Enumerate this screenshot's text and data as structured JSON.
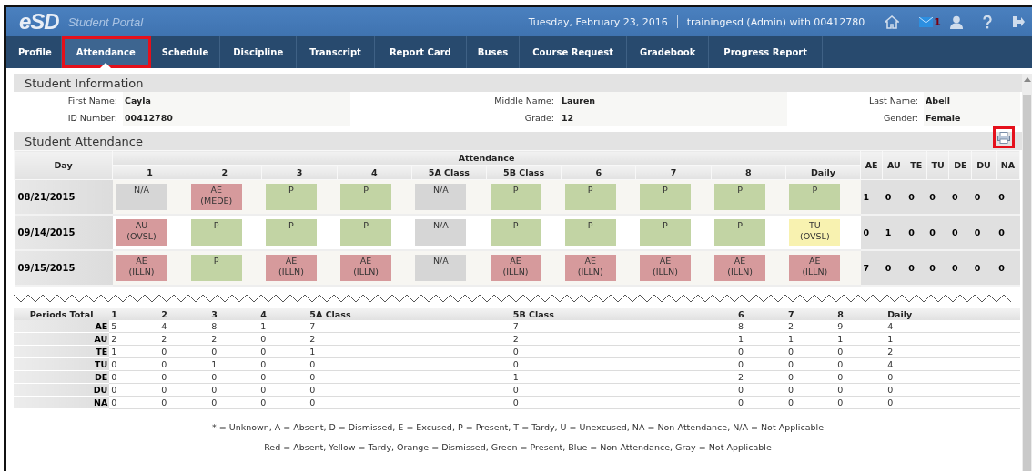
{
  "header": {
    "logo": "eSD",
    "portal_name": "Student Portal",
    "date": "Tuesday, February 23, 2016",
    "user": "trainingesd (Admin) with 00412780",
    "mail_count": "1"
  },
  "tabs": [
    {
      "label": "Profile",
      "selected": false,
      "highlighted": false
    },
    {
      "label": "Attendance",
      "selected": true,
      "highlighted": true
    },
    {
      "label": "Schedule",
      "selected": false,
      "highlighted": false
    },
    {
      "label": "Discipline",
      "selected": false,
      "highlighted": false
    },
    {
      "label": "Transcript",
      "selected": false,
      "highlighted": false
    },
    {
      "label": "Report Card",
      "selected": false,
      "highlighted": false
    },
    {
      "label": "Buses",
      "selected": false,
      "highlighted": false
    },
    {
      "label": "Course Request",
      "selected": false,
      "highlighted": false
    },
    {
      "label": "Gradebook",
      "selected": false,
      "highlighted": false
    },
    {
      "label": "Progress Report",
      "selected": false,
      "highlighted": false
    }
  ],
  "student_information": {
    "title": "Student Information",
    "fields": [
      {
        "label": "First Name:",
        "value": "Cayla"
      },
      {
        "label": "Middle Name:",
        "value": "Lauren"
      },
      {
        "label": "Last Name:",
        "value": "Abell"
      },
      {
        "label": "ID Number:",
        "value": "00412780"
      },
      {
        "label": "Grade:",
        "value": "12"
      },
      {
        "label": "Gender:",
        "value": "Female"
      }
    ]
  },
  "student_attendance": {
    "title": "Student Attendance",
    "print_highlighted": true,
    "day_header": "Day",
    "group_header": "Attendance",
    "periods": [
      "1",
      "2",
      "3",
      "4",
      "5A Class",
      "5B Class",
      "6",
      "7",
      "8",
      "Daily"
    ],
    "totals_columns": [
      "AE",
      "AU",
      "TE",
      "TU",
      "DE",
      "DU",
      "NA"
    ],
    "rows": [
      {
        "day": "08/21/2015",
        "cells": [
          {
            "code": "N/A",
            "color": "#d6d6d6"
          },
          {
            "code": "AE",
            "reason": "(MEDE)",
            "color": "#d69a9c"
          },
          {
            "code": "P",
            "color": "#c2d4a4"
          },
          {
            "code": "P",
            "color": "#c2d4a4"
          },
          {
            "code": "N/A",
            "color": "#d6d6d6"
          },
          {
            "code": "P",
            "color": "#c2d4a4"
          },
          {
            "code": "P",
            "color": "#c2d4a4"
          },
          {
            "code": "P",
            "color": "#c2d4a4"
          },
          {
            "code": "P",
            "color": "#c2d4a4"
          },
          {
            "code": "P",
            "color": "#c2d4a4"
          }
        ],
        "totals": [
          "1",
          "0",
          "0",
          "0",
          "0",
          "0",
          "0"
        ]
      },
      {
        "day": "09/14/2015",
        "cells": [
          {
            "code": "AU",
            "reason": "(OVSL)",
            "color": "#d69a9c"
          },
          {
            "code": "P",
            "color": "#c2d4a4"
          },
          {
            "code": "P",
            "color": "#c2d4a4"
          },
          {
            "code": "P",
            "color": "#c2d4a4"
          },
          {
            "code": "N/A",
            "color": "#d6d6d6"
          },
          {
            "code": "P",
            "color": "#c2d4a4"
          },
          {
            "code": "P",
            "color": "#c2d4a4"
          },
          {
            "code": "P",
            "color": "#c2d4a4"
          },
          {
            "code": "P",
            "color": "#c2d4a4"
          },
          {
            "code": "TU",
            "reason": "(OVSL)",
            "color": "#f8f2b0"
          }
        ],
        "totals": [
          "0",
          "1",
          "0",
          "0",
          "0",
          "0",
          "0"
        ]
      },
      {
        "day": "09/15/2015",
        "cells": [
          {
            "code": "AE",
            "reason": "(ILLN)",
            "color": "#d69a9c"
          },
          {
            "code": "P",
            "color": "#c2d4a4"
          },
          {
            "code": "AE",
            "reason": "(ILLN)",
            "color": "#d69a9c"
          },
          {
            "code": "AE",
            "reason": "(ILLN)",
            "color": "#d69a9c"
          },
          {
            "code": "N/A",
            "color": "#d6d6d6"
          },
          {
            "code": "AE",
            "reason": "(ILLN)",
            "color": "#d69a9c"
          },
          {
            "code": "AE",
            "reason": "(ILLN)",
            "color": "#d69a9c"
          },
          {
            "code": "AE",
            "reason": "(ILLN)",
            "color": "#d69a9c"
          },
          {
            "code": "AE",
            "reason": "(ILLN)",
            "color": "#d69a9c"
          },
          {
            "code": "AE",
            "reason": "(ILLN)",
            "color": "#d69a9c"
          }
        ],
        "totals": [
          "7",
          "0",
          "0",
          "0",
          "0",
          "0",
          "0"
        ]
      }
    ]
  },
  "periods_total": {
    "title": "Periods Total",
    "columns": [
      "1",
      "2",
      "3",
      "4",
      "5A Class",
      "5B Class",
      "6",
      "7",
      "8",
      "Daily"
    ],
    "rows": [
      {
        "label": "AE",
        "values": [
          "5",
          "4",
          "8",
          "1",
          "7",
          "7",
          "8",
          "2",
          "9",
          "4"
        ]
      },
      {
        "label": "AU",
        "values": [
          "2",
          "2",
          "2",
          "0",
          "2",
          "2",
          "1",
          "1",
          "1",
          "1"
        ]
      },
      {
        "label": "TE",
        "values": [
          "1",
          "0",
          "0",
          "0",
          "1",
          "0",
          "0",
          "0",
          "0",
          "2"
        ]
      },
      {
        "label": "TU",
        "values": [
          "0",
          "0",
          "1",
          "0",
          "0",
          "0",
          "0",
          "0",
          "0",
          "4"
        ]
      },
      {
        "label": "DE",
        "values": [
          "0",
          "0",
          "0",
          "0",
          "0",
          "1",
          "2",
          "0",
          "0",
          "0"
        ]
      },
      {
        "label": "DU",
        "values": [
          "0",
          "0",
          "0",
          "0",
          "0",
          "0",
          "0",
          "0",
          "0",
          "0"
        ]
      },
      {
        "label": "NA",
        "values": [
          "0",
          "0",
          "0",
          "0",
          "0",
          "0",
          "0",
          "0",
          "0",
          "0"
        ]
      }
    ]
  },
  "legend": [
    "* = Unknown, A = Absent, D = Dismissed, E = Excused, P = Present, T = Tardy, U = Unexcused, NA = Non-Attendance, N/A = Not Applicable",
    "Red = Absent, Yellow = Tardy, Orange = Dismissed, Green = Present, Blue = Non-Attendance, Gray = Not Applicable"
  ]
}
